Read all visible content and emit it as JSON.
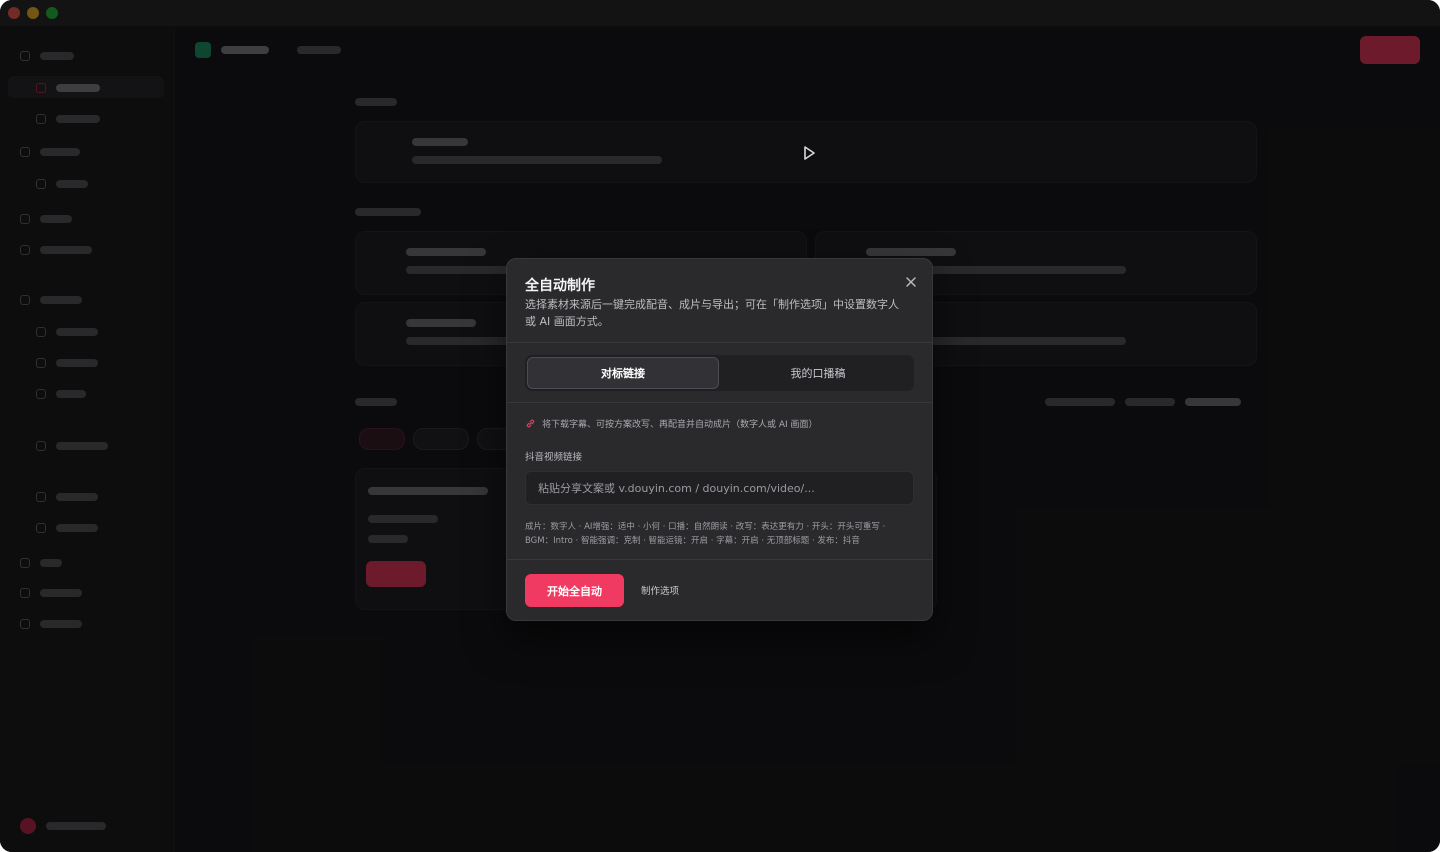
{
  "modal": {
    "title": "全自动制作",
    "description": "选择素材来源后一键完成配音、成片与导出；可在「制作选项」中设置数字人或 AI 画面方式。",
    "tabs": [
      {
        "label": "对标链接",
        "active": true
      },
      {
        "label": "我的口播稿",
        "active": false
      }
    ],
    "hint": "将下载字幕、可按方案改写、再配音并自动成片（数字人或 AI 画面）",
    "field_label": "抖音视频链接",
    "input_placeholder": "粘贴分享文案或 v.douyin.com / douyin.com/video/...",
    "input_value": "",
    "settings_line1": "成片：数字人 · AI增强：适中 · 小何 · 口播：自然朗读 · 改写：表达更有力 · 开头：开头可重写 ·",
    "settings_line2": "BGM：Intro · 智能强调：克制 · 智能运镜：开启 · 字幕：开启 · 无顶部标题 · 发布：抖音",
    "primary_button": "开始全自动",
    "secondary_button": "制作选项"
  },
  "colors": {
    "accent": "#f03a62",
    "modal_bg": "#2a2a2d",
    "backdrop": "#1a1a1d"
  },
  "icons": [
    "close-icon",
    "link-icon",
    "play-icon"
  ]
}
